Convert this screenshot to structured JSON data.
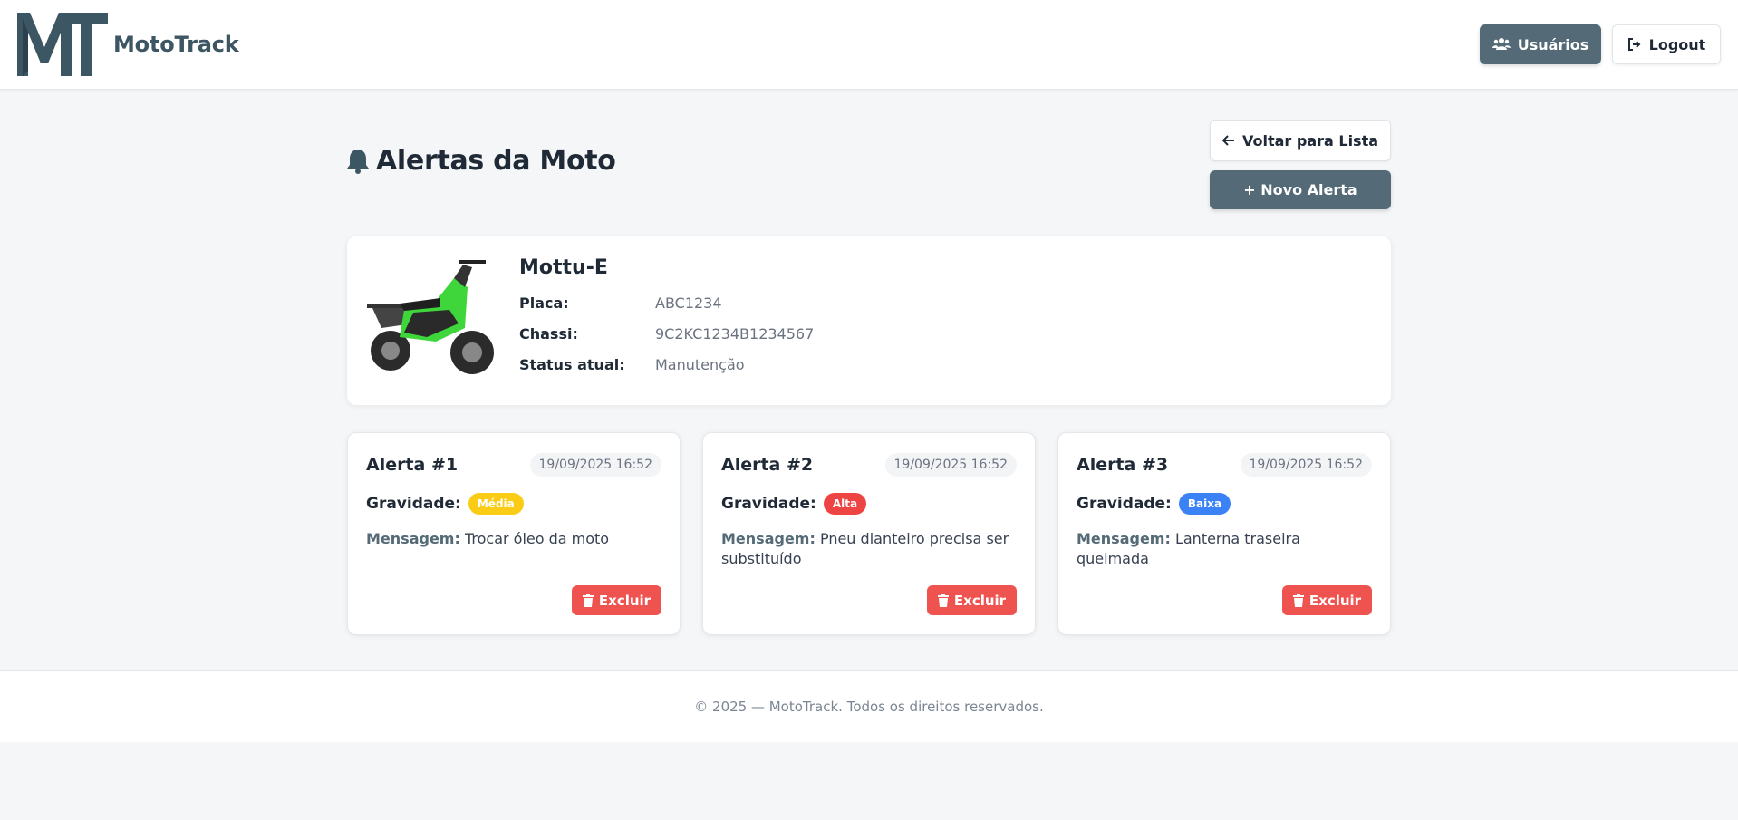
{
  "header": {
    "brand": "MotoTrack",
    "users_label": "Usuários",
    "logout_label": "Logout"
  },
  "page": {
    "title": "Alertas da Moto",
    "back_label": "Voltar para Lista",
    "new_alert_label": "+ Novo Alerta"
  },
  "moto": {
    "name": "Mottu-E",
    "fields": [
      {
        "label": "Placa:",
        "value": "ABC1234"
      },
      {
        "label": "Chassi:",
        "value": "9C2KC1234B1234567"
      },
      {
        "label": "Status atual:",
        "value": "Manutenção"
      }
    ]
  },
  "alerts": [
    {
      "title": "Alerta #1",
      "date": "19/09/2025 16:52",
      "severity_label": "Gravidade:",
      "severity": "Média",
      "severity_color": "#facc15",
      "message_label": "Mensagem:",
      "message": "Trocar óleo da moto",
      "delete_label": "Excluir"
    },
    {
      "title": "Alerta #2",
      "date": "19/09/2025 16:52",
      "severity_label": "Gravidade:",
      "severity": "Alta",
      "severity_color": "#ef4444",
      "message_label": "Mensagem:",
      "message": "Pneu dianteiro precisa ser substituído",
      "delete_label": "Excluir"
    },
    {
      "title": "Alerta #3",
      "date": "19/09/2025 16:52",
      "severity_label": "Gravidade:",
      "severity": "Baixa",
      "severity_color": "#3b82f6",
      "message_label": "Mensagem:",
      "message": "Lanterna traseira queimada",
      "delete_label": "Excluir"
    }
  ],
  "footer": {
    "text": "© 2025 — MotoTrack. Todos os direitos reservados."
  },
  "colors": {
    "primary": "#546a76",
    "danger": "#ef5350"
  },
  "icons": [
    "mt-logo",
    "users-icon",
    "logout-icon",
    "bell-icon",
    "arrow-left-icon",
    "plus-icon",
    "trash-icon",
    "motorcycle-image"
  ]
}
